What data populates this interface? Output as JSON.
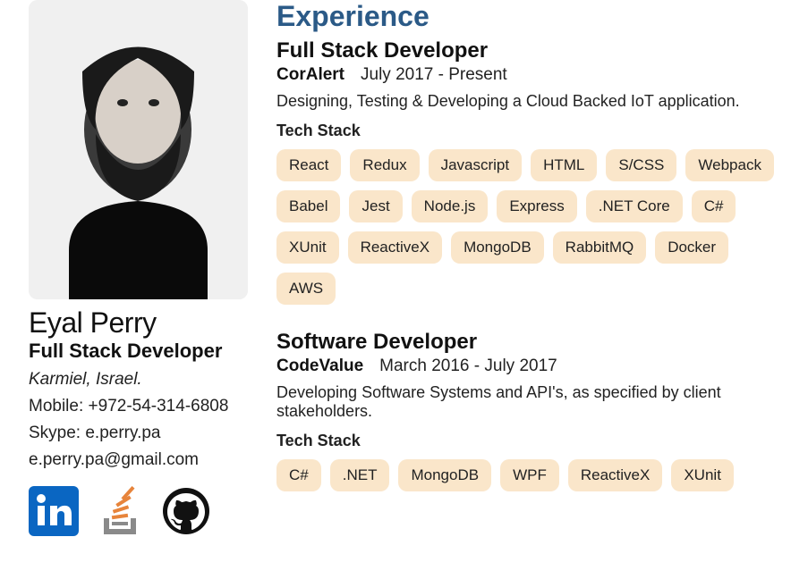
{
  "sidebar": {
    "name": "Eyal Perry",
    "title": "Full Stack Developer",
    "location": "Karmiel, Israel.",
    "mobile": "Mobile: +972-54-314-6808",
    "skype": "Skype: e.perry.pa",
    "email": "e.perry.pa@gmail.com",
    "icons": {
      "linkedin": "linkedin-icon",
      "stackoverflow": "stackoverflow-icon",
      "github": "github-icon"
    }
  },
  "main": {
    "section_heading": "Experience",
    "jobs": [
      {
        "title": "Full Stack Developer",
        "company": "CorAlert",
        "dates": "July 2017 - Present",
        "desc": "Designing, Testing & Developing a Cloud Backed IoT application.",
        "stack_label": "Tech Stack",
        "tags": [
          "React",
          "Redux",
          "Javascript",
          "HTML",
          "S/CSS",
          "Webpack",
          "Babel",
          "Jest",
          "Node.js",
          "Express",
          ".NET Core",
          "C#",
          "XUnit",
          "ReactiveX",
          "MongoDB",
          "RabbitMQ",
          "Docker",
          "AWS"
        ]
      },
      {
        "title": "Software Developer",
        "company": "CodeValue",
        "dates": "March 2016 - July 2017",
        "desc": "Developing Software Systems and API's, as specified by client stakeholders.",
        "stack_label": "Tech Stack",
        "tags": [
          "C#",
          ".NET",
          "MongoDB",
          "WPF",
          "ReactiveX",
          "XUnit"
        ]
      }
    ]
  }
}
